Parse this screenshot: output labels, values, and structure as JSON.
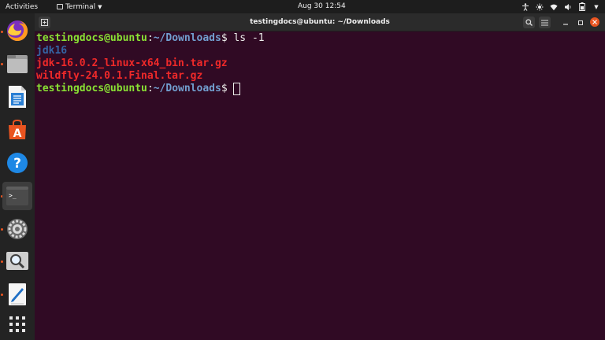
{
  "topbar": {
    "activities": "Activities",
    "app_name": "Terminal",
    "clock": "Aug 30  12:54"
  },
  "window": {
    "title": "testingdocs@ubuntu: ~/Downloads"
  },
  "terminal": {
    "prompt_user": "testingdocs@ubuntu",
    "prompt_sep": ":",
    "prompt_path": "~/Downloads",
    "prompt_dollar": "$ ",
    "command": "ls -1",
    "output": [
      {
        "text": "jdk16",
        "kind": "directory"
      },
      {
        "text": "jdk-16.0.2_linux-x64_bin.tar.gz",
        "kind": "archive"
      },
      {
        "text": "wildfly-24.0.1.Final.tar.gz",
        "kind": "archive"
      }
    ]
  },
  "dock": {
    "items": [
      "firefox-icon",
      "files-icon",
      "writer-icon",
      "software-icon",
      "help-icon",
      "terminal-icon",
      "settings-icon",
      "screenshot-icon",
      "text-editor-icon",
      "show-apps-icon"
    ]
  },
  "colors": {
    "terminal_bg": "#300a24",
    "prompt_user": "#8ae234",
    "prompt_path": "#729fcf",
    "directory": "#3465a4",
    "archive": "#ef2929",
    "accent": "#e95420"
  }
}
